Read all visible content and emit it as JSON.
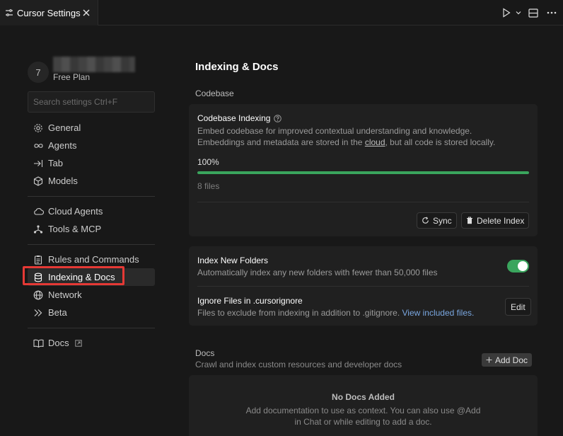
{
  "tab": {
    "title": "Cursor Settings",
    "icon": "settings-sliders-icon",
    "close_icon": "close-icon"
  },
  "toolbar": {
    "run_icon": "play-icon",
    "run_menu_icon": "chevron-down-icon",
    "split_icon": "split-editor-icon",
    "more_icon": "ellipsis-icon"
  },
  "profile": {
    "avatar_initial": "7",
    "name": "",
    "plan": "Free Plan"
  },
  "search": {
    "placeholder": "Search settings Ctrl+F"
  },
  "sidebar": {
    "group1": [
      {
        "label": "General",
        "icon": "gear-icon"
      },
      {
        "label": "Agents",
        "icon": "infinity-icon"
      },
      {
        "label": "Tab",
        "icon": "arrow-right-to-line-icon"
      },
      {
        "label": "Models",
        "icon": "cube-icon"
      }
    ],
    "group2": [
      {
        "label": "Cloud Agents",
        "icon": "cloud-icon"
      },
      {
        "label": "Tools & MCP",
        "icon": "nodes-icon"
      }
    ],
    "group3": [
      {
        "label": "Rules and Commands",
        "icon": "clipboard-icon"
      },
      {
        "label": "Indexing & Docs",
        "icon": "database-icon",
        "active": true
      },
      {
        "label": "Network",
        "icon": "globe-icon"
      },
      {
        "label": "Beta",
        "icon": "chevrons-right-icon"
      }
    ],
    "group4": [
      {
        "label": "Docs",
        "icon": "book-icon",
        "external_icon": "external-link-icon"
      }
    ]
  },
  "main": {
    "title": "Indexing & Docs",
    "codebase_label": "Codebase",
    "codebase_card": {
      "title": "Codebase Indexing",
      "help_icon": "help-circle-icon",
      "desc_line1": "Embed codebase for improved contextual understanding and knowledge.",
      "desc_line2_pre": "Embeddings and metadata are stored in the ",
      "desc_line2_link": "cloud",
      "desc_line2_post": ", but all code is stored locally.",
      "progress_text": "100%",
      "progress_fraction": 1.0,
      "files": "8 files",
      "sync_label": "Sync",
      "sync_icon": "refresh-icon",
      "delete_label": "Delete Index",
      "delete_icon": "trash-icon"
    },
    "folders_card": {
      "index_new_title": "Index New Folders",
      "index_new_desc": "Automatically index any new folders with fewer than 50,000 files",
      "index_new_enabled": true,
      "ignore_title": "Ignore Files in .cursorignore",
      "ignore_desc_pre": "Files to exclude from indexing in addition to .gitignore. ",
      "ignore_desc_link": "View included files.",
      "edit_label": "Edit"
    },
    "docs": {
      "label": "Docs",
      "desc": "Crawl and index custom resources and developer docs",
      "add_label": "Add Doc",
      "add_icon": "plus-icon",
      "empty_title": "No Docs Added",
      "empty_desc_line1": "Add documentation to use as context. You can also use @Add",
      "empty_desc_line2": "in Chat or while editing to add a doc."
    }
  },
  "colors": {
    "accent_green": "#3aa55d",
    "highlight_red": "#e53935",
    "link_blue": "#7aa7e0"
  }
}
